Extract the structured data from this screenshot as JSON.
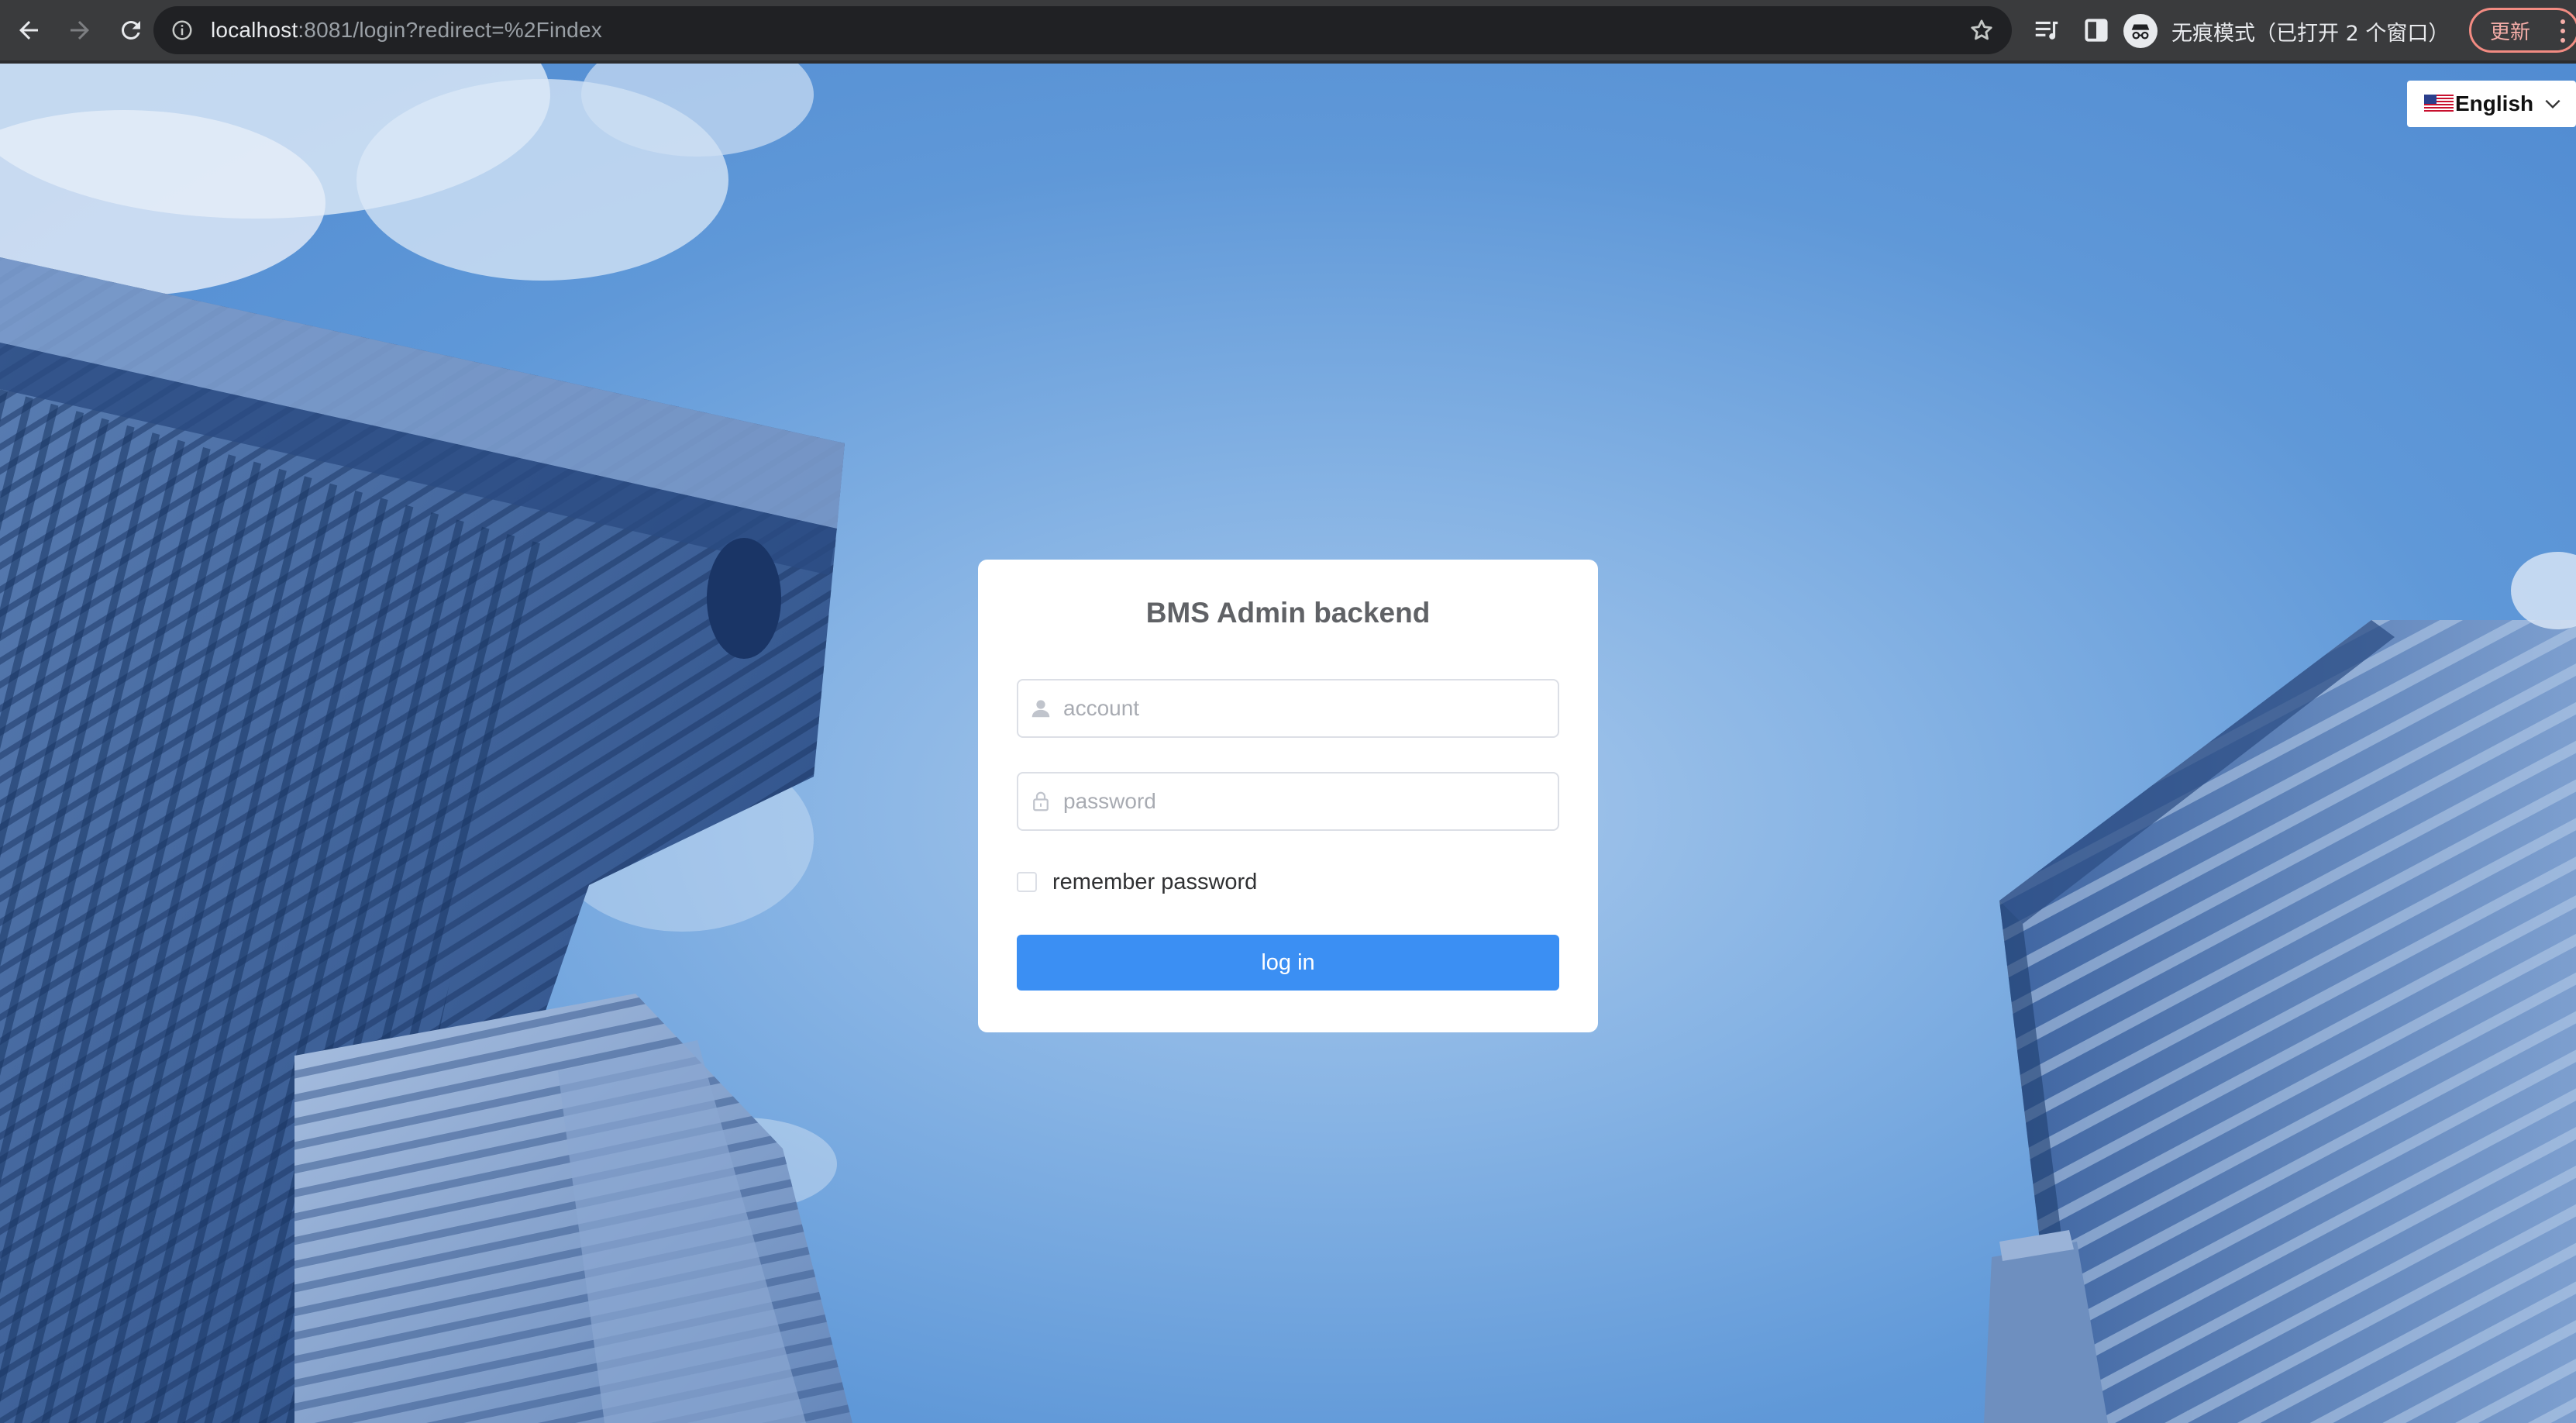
{
  "browser": {
    "url_host": "localhost",
    "url_rest": ":8081/login?redirect=%2Findex",
    "incognito_label": "无痕模式（已打开 2 个窗口）",
    "update_label": "更新"
  },
  "language": {
    "selected": "English",
    "flag_icon": "us-flag-icon"
  },
  "login": {
    "title": "BMS Admin backend",
    "account_placeholder": "account",
    "account_value": "",
    "password_placeholder": "password",
    "password_value": "",
    "remember_label": "remember password",
    "remember_checked": false,
    "submit_label": "log in"
  },
  "colors": {
    "primary_button": "#3b8ff3",
    "background_sky": "#5f98d8",
    "card_background": "#ffffff",
    "title_text": "#606266",
    "update_accent": "#f28b82"
  }
}
